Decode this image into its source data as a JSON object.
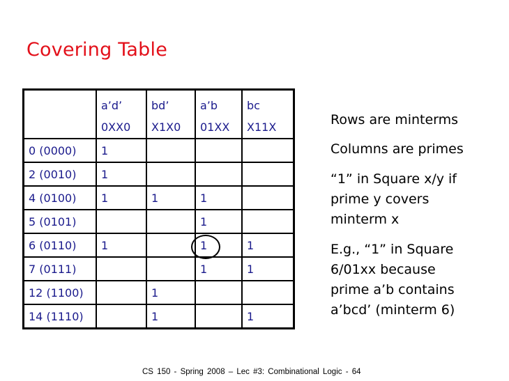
{
  "slide": {
    "title": "Covering Table",
    "title_color": "#e3101a",
    "text_color_table": "#1a1a8c",
    "footer": "CS 150 - Spring  2008 – Lec #3: Combinational  Logic  - 64"
  },
  "table": {
    "primes": [
      {
        "expr": "a’d’",
        "pattern": "0XX0"
      },
      {
        "expr": "bd’",
        "pattern": "X1X0"
      },
      {
        "expr": "a’b",
        "pattern": "01XX"
      },
      {
        "expr": "bc",
        "pattern": "X11X"
      }
    ],
    "rows": [
      {
        "minterm": "0 (0000)",
        "cells": [
          "1",
          "",
          "",
          ""
        ]
      },
      {
        "minterm": "2 (0010)",
        "cells": [
          "1",
          "",
          "",
          ""
        ]
      },
      {
        "minterm": "4 (0100)",
        "cells": [
          "1",
          "1",
          "1",
          ""
        ]
      },
      {
        "minterm": "5 (0101)",
        "cells": [
          "",
          "",
          "1",
          ""
        ]
      },
      {
        "minterm": "6 (0110)",
        "cells": [
          "1",
          "",
          "1",
          "1"
        ],
        "circled_col": 2
      },
      {
        "minterm": "7 (0111)",
        "cells": [
          "",
          "",
          "1",
          "1"
        ]
      },
      {
        "minterm": "12 (1100)",
        "cells": [
          "",
          "1",
          "",
          ""
        ]
      },
      {
        "minterm": "14 (1110)",
        "cells": [
          "",
          "1",
          "",
          "1"
        ]
      }
    ]
  },
  "notes": [
    [
      "Rows are minterms"
    ],
    [
      "Columns are primes"
    ],
    [
      "“1” in Square x/y if",
      "prime y covers",
      "minterm x"
    ],
    [
      "E.g., “1” in Square",
      "6/01xx because",
      "prime a’b contains",
      "a’bcd’ (minterm 6)"
    ]
  ]
}
